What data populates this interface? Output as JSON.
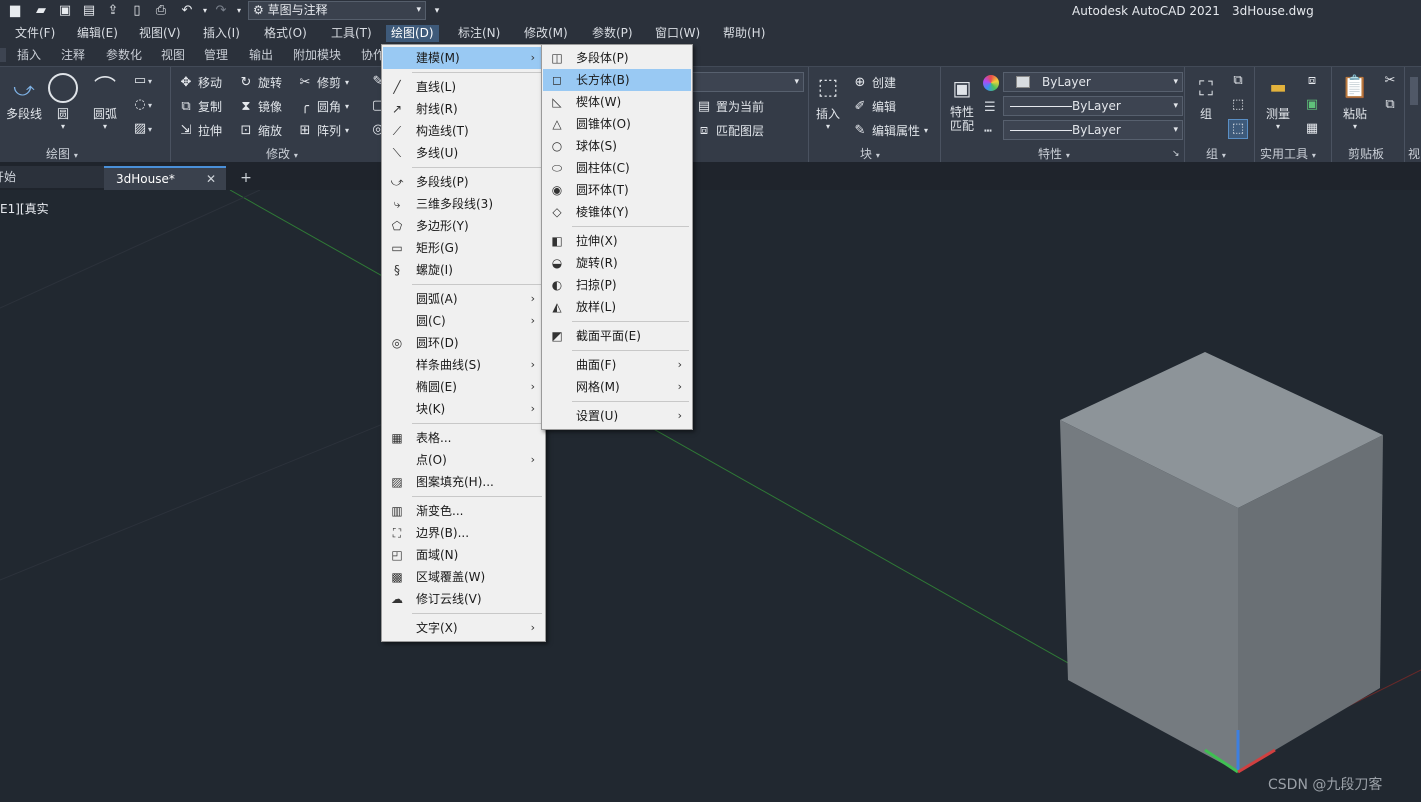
{
  "app": {
    "title": "Autodesk AutoCAD 2021",
    "file": "3dHouse.dwg",
    "workspace": "草图与注释"
  },
  "quick_access": [
    "new-icon",
    "open-icon",
    "save-icon",
    "saveas-icon",
    "upload-icon",
    "share-icon",
    "print-icon",
    "undo-icon",
    "redo-icon"
  ],
  "menubar": [
    "文件(F)",
    "编辑(E)",
    "视图(V)",
    "插入(I)",
    "格式(O)",
    "工具(T)",
    "绘图(D)",
    "标注(N)",
    "修改(M)",
    "参数(P)",
    "窗口(W)",
    "帮助(H)"
  ],
  "ribbon_tabs": [
    "插入",
    "注释",
    "参数化",
    "视图",
    "管理",
    "输出",
    "附加模块",
    "协作"
  ],
  "ribbon": {
    "draw": {
      "polyline": "多段线",
      "circle": "圆",
      "arc": "圆弧",
      "title": "绘图"
    },
    "modify": {
      "move": "移动",
      "rotate": "旋转",
      "trim": "修剪",
      "copy": "复制",
      "mirror": "镜像",
      "fillet": "圆角",
      "stretch": "拉伸",
      "scale": "缩放",
      "array": "阵列",
      "title": "修改"
    },
    "layers": {
      "set_current": "置为当前",
      "match_layer": "匹配图层"
    },
    "block": {
      "insert": "插入",
      "create": "创建",
      "edit": "编辑",
      "edit_attr": "编辑属性",
      "title": "块"
    },
    "properties": {
      "match": "特性",
      "match2": "匹配",
      "color": "ByLayer",
      "linetype": "ByLayer",
      "lineweight": "ByLayer",
      "title": "特性"
    },
    "groups": {
      "group": "组",
      "title": "组"
    },
    "utilities": {
      "measure": "测量",
      "title": "实用工具"
    },
    "clipboard": {
      "paste": "粘贴",
      "title": "剪贴板"
    },
    "view_cut": "视"
  },
  "doc_tabs": {
    "start": "开始",
    "drawing": "3dHouse*"
  },
  "viewport_label": "E1][真实",
  "draw_menu": {
    "items": [
      {
        "label": "建模(M)",
        "icon": "",
        "arrow": true,
        "hl": true
      },
      {
        "sep": true
      },
      {
        "label": "直线(L)",
        "icon": "line-icon"
      },
      {
        "label": "射线(R)",
        "icon": "ray-icon"
      },
      {
        "label": "构造线(T)",
        "icon": "xline-icon"
      },
      {
        "label": "多线(U)",
        "icon": "mline-icon"
      },
      {
        "sep": true
      },
      {
        "label": "多段线(P)",
        "icon": "polyline-icon"
      },
      {
        "label": "三维多段线(3)",
        "icon": "3dpoly-icon"
      },
      {
        "label": "多边形(Y)",
        "icon": "polygon-icon"
      },
      {
        "label": "矩形(G)",
        "icon": "rectangle-icon"
      },
      {
        "label": "螺旋(I)",
        "icon": "helix-icon"
      },
      {
        "sep": true
      },
      {
        "label": "圆弧(A)",
        "arrow": true
      },
      {
        "label": "圆(C)",
        "arrow": true
      },
      {
        "label": "圆环(D)",
        "icon": "donut-icon"
      },
      {
        "label": "样条曲线(S)",
        "arrow": true
      },
      {
        "label": "椭圆(E)",
        "arrow": true
      },
      {
        "label": "块(K)",
        "arrow": true
      },
      {
        "sep": true
      },
      {
        "label": "表格...",
        "icon": "table-icon"
      },
      {
        "label": "点(O)",
        "arrow": true
      },
      {
        "label": "图案填充(H)...",
        "icon": "hatch-icon"
      },
      {
        "sep": true
      },
      {
        "label": "渐变色...",
        "icon": "gradient-icon"
      },
      {
        "label": "边界(B)...",
        "icon": "boundary-icon"
      },
      {
        "label": "面域(N)",
        "icon": "region-icon"
      },
      {
        "label": "区域覆盖(W)",
        "icon": "wipeout-icon"
      },
      {
        "label": "修订云线(V)",
        "icon": "revcloud-icon"
      },
      {
        "sep": true
      },
      {
        "label": "文字(X)",
        "arrow": true
      }
    ]
  },
  "modeling_menu": {
    "items": [
      {
        "label": "多段体(P)",
        "icon": "polysolid-icon"
      },
      {
        "label": "长方体(B)",
        "icon": "box-icon",
        "hl": true
      },
      {
        "label": "楔体(W)",
        "icon": "wedge-icon"
      },
      {
        "label": "圆锥体(O)",
        "icon": "cone-icon"
      },
      {
        "label": "球体(S)",
        "icon": "sphere-icon"
      },
      {
        "label": "圆柱体(C)",
        "icon": "cylinder-icon"
      },
      {
        "label": "圆环体(T)",
        "icon": "torus-icon"
      },
      {
        "label": "棱锥体(Y)",
        "icon": "pyramid-icon"
      },
      {
        "sep": true
      },
      {
        "label": "拉伸(X)",
        "icon": "extrude-icon"
      },
      {
        "label": "旋转(R)",
        "icon": "revolve-icon"
      },
      {
        "label": "扫掠(P)",
        "icon": "sweep-icon"
      },
      {
        "label": "放样(L)",
        "icon": "loft-icon"
      },
      {
        "sep": true
      },
      {
        "label": "截面平面(E)",
        "icon": "sectionplane-icon"
      },
      {
        "sep": true
      },
      {
        "label": "曲面(F)",
        "arrow": true
      },
      {
        "label": "网格(M)",
        "arrow": true
      },
      {
        "sep": true
      },
      {
        "label": "设置(U)",
        "arrow": true
      }
    ]
  },
  "watermark": "CSDN @九段刀客",
  "colors": {
    "highlight": "#99c9f3",
    "cube_light": "#8c9398",
    "cube_side": "#6f7579"
  }
}
